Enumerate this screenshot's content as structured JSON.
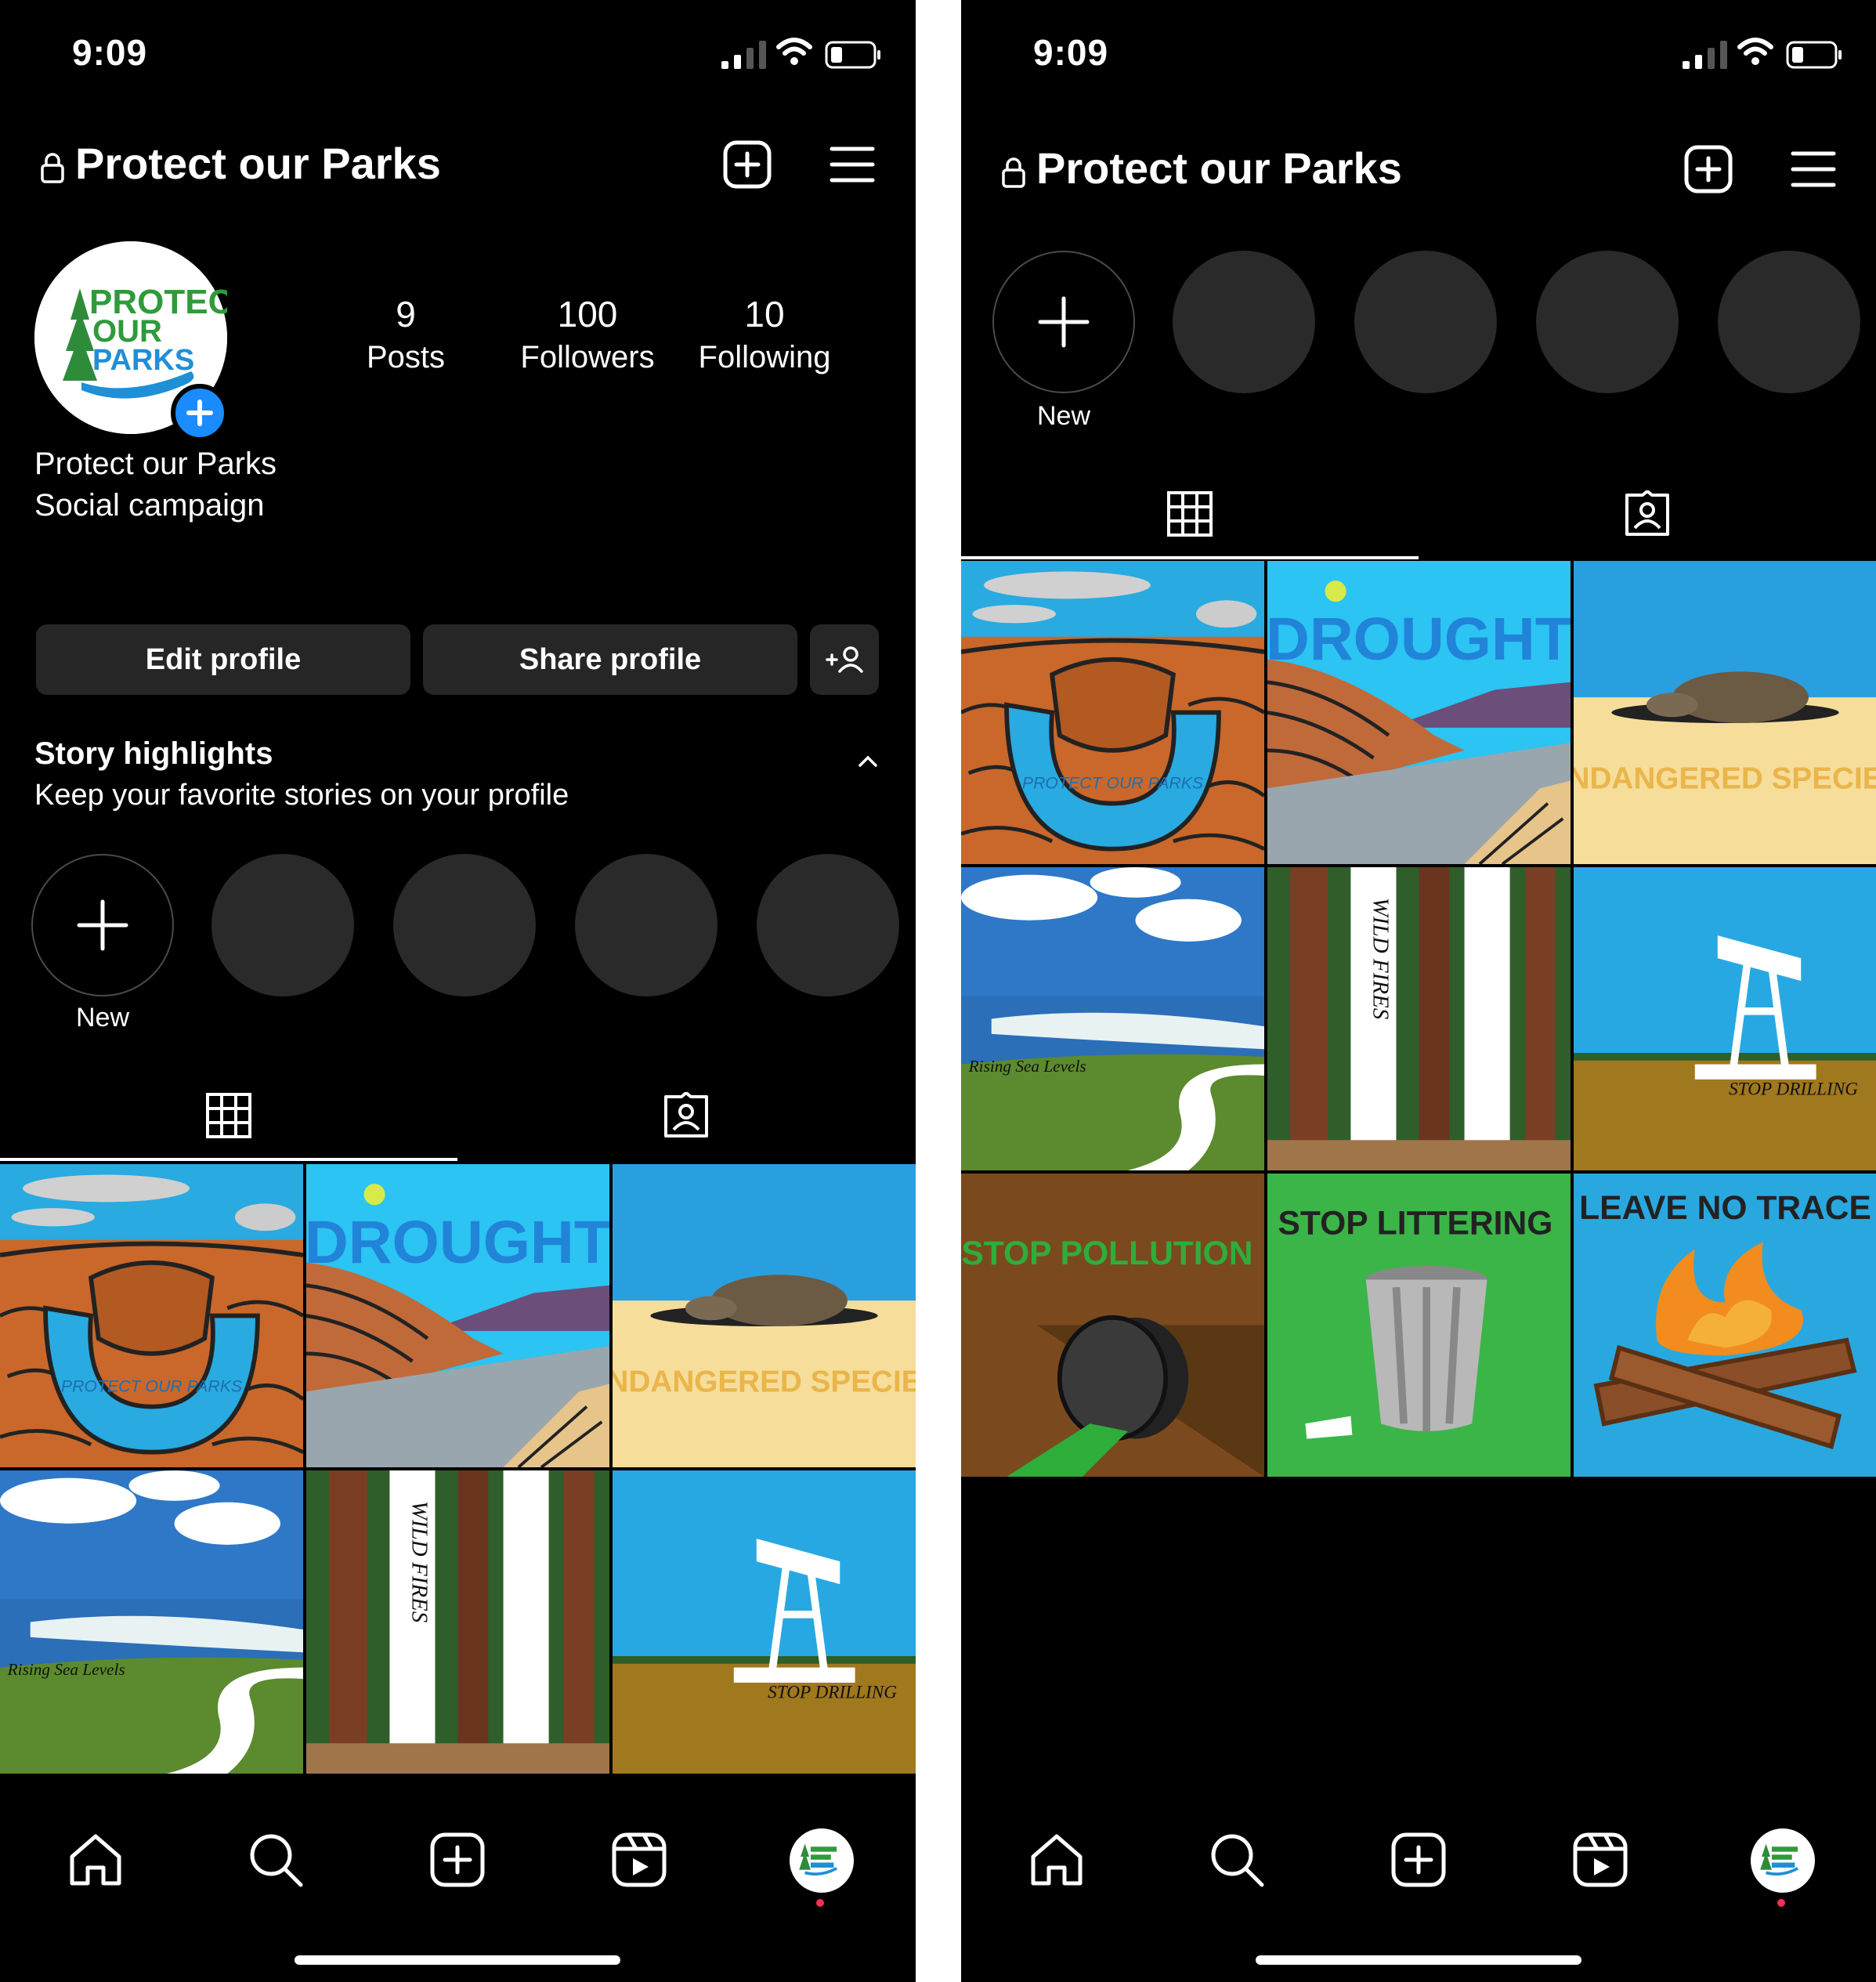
{
  "status_bar": {
    "time": "9:09"
  },
  "header": {
    "account_name": "Protect our Parks"
  },
  "profile": {
    "logo_text": [
      "PROTECT",
      "OUR",
      "PARKS"
    ],
    "stats": [
      {
        "value": "9",
        "label": "Posts"
      },
      {
        "value": "100",
        "label": "Followers"
      },
      {
        "value": "10",
        "label": "Following"
      }
    ],
    "display_name": "Protect our Parks",
    "category": "Social campaign",
    "edit_profile_label": "Edit profile",
    "share_profile_label": "Share profile"
  },
  "highlights": {
    "title": "Story highlights",
    "subtitle": "Keep your favorite stories on your profile",
    "new_label": "New"
  },
  "posts": [
    {
      "text": "PROTECT OUR PARKS",
      "theme": "canyon"
    },
    {
      "text": "DROUGHT",
      "theme": "lake"
    },
    {
      "text": "ENDANGERED SPECIES",
      "theme": "turtle"
    },
    {
      "text": "Rising Sea Levels",
      "theme": "coast"
    },
    {
      "text": "WILD FIRES",
      "theme": "forest"
    },
    {
      "text": "STOP DRILLING",
      "theme": "oil"
    },
    {
      "text": "STOP POLLUTION",
      "theme": "pipe"
    },
    {
      "text": "STOP LITTERING",
      "theme": "trash"
    },
    {
      "text": "LEAVE NO TRACE",
      "theme": "campfire"
    }
  ],
  "colors": {
    "accent": "#1a8cff",
    "button_bg": "#262626",
    "story_bg": "#2a2a2a",
    "notification_dot": "#ff2d55"
  }
}
